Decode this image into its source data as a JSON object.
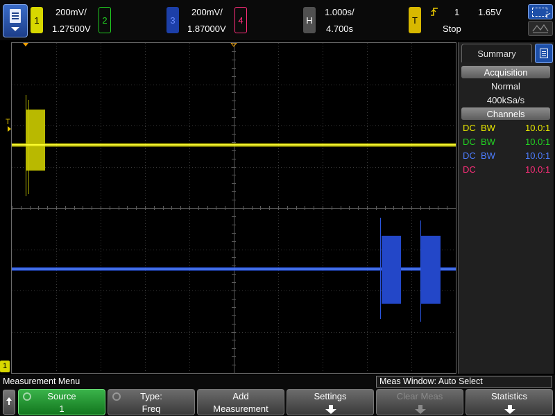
{
  "colors": {
    "ch1": "#e8e800",
    "ch2": "#22d022",
    "ch3": "#2a5cff",
    "ch4": "#ff2e7a",
    "trigger": "#e8c800"
  },
  "header": {
    "ch1": {
      "number": "1",
      "scale": "200mV/",
      "offset": "1.27500V"
    },
    "ch2": {
      "number": "2"
    },
    "ch3": {
      "number": "3",
      "scale": "200mV/",
      "offset": "1.87000V"
    },
    "ch4": {
      "number": "4"
    },
    "timebase": {
      "badge": "H",
      "scale": "1.000s/",
      "delay": "4.700s"
    },
    "trigger": {
      "badge": "T",
      "edge_icon": "rising-edge-icon",
      "source": "1",
      "level": "1.65V",
      "status": "Stop"
    }
  },
  "scope": {
    "trigger_marker": "T",
    "ground_marker": "1"
  },
  "summary": {
    "tab_label": "Summary",
    "acquisition_header": "Acquisition",
    "acq_mode": "Normal",
    "sample_rate": "400kSa/s",
    "channels_header": "Channels",
    "channels": [
      {
        "coupling": "DC",
        "bw": "BW",
        "probe": "10.0:1"
      },
      {
        "coupling": "DC",
        "bw": "BW",
        "probe": "10.0:1"
      },
      {
        "coupling": "DC",
        "bw": "BW",
        "probe": "10.0:1"
      },
      {
        "coupling": "DC",
        "bw": "",
        "probe": "10.0:1"
      }
    ]
  },
  "menu": {
    "title": "Measurement Menu",
    "meas_window": "Meas Window: Auto Select",
    "softkeys": {
      "source": {
        "line1": "Source",
        "line2": "1"
      },
      "type": {
        "line1": "Type:",
        "line2": "Freq"
      },
      "add": {
        "line1": "Add",
        "line2": "Measurement"
      },
      "settings": {
        "line1": "Settings"
      },
      "clear": {
        "line1": "Clear Meas"
      },
      "statistics": {
        "line1": "Statistics"
      }
    }
  }
}
